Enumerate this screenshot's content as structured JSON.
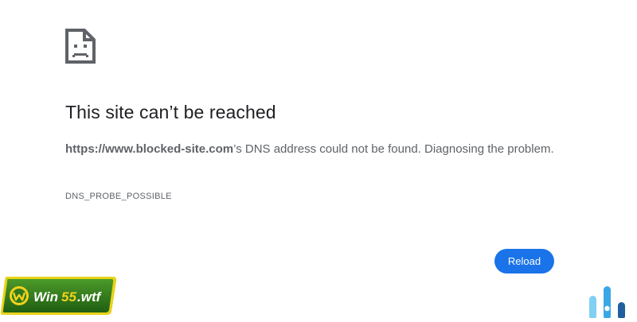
{
  "error": {
    "icon": "sad-page-icon",
    "title": "This site can’t be reached",
    "host": "https://www.blocked-site.com",
    "message": "’s DNS address could not be found. Diagnosing the problem.",
    "code": "DNS_PROBE_POSSIBLE"
  },
  "actions": {
    "reload_label": "Reload"
  },
  "watermark": {
    "text": "Win55.wtf",
    "icon": "win55-logo-icon"
  },
  "brand_mark": {
    "icon": "bars-logo-icon"
  },
  "colors": {
    "accent": "#1a73e8",
    "text_primary": "#202124",
    "text_secondary": "#5f6368",
    "badge_green": "#2f7a1e",
    "badge_yellow": "#f3d21b"
  }
}
